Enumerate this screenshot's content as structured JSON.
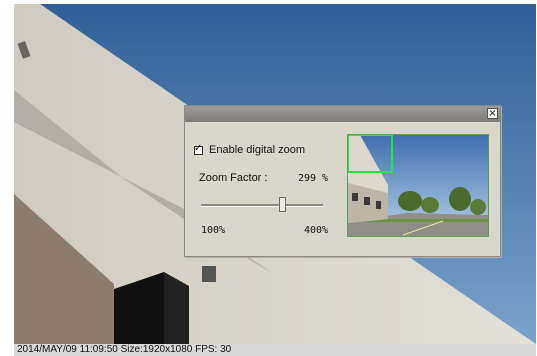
{
  "status_bar": {
    "text": "2014/MAY/09 11:09:50 Size:1920x1080 FPS: 30"
  },
  "zoom_dialog": {
    "close_glyph": "×",
    "enable_label": "Enable digital zoom",
    "enable_checked": true,
    "zoom_factor_label": "Zoom Factor :",
    "zoom_factor_value": "299",
    "zoom_factor_unit": "%",
    "slider": {
      "min_label": "100%",
      "max_label": "400%",
      "min": 100,
      "max": 400,
      "value": 299
    }
  },
  "icons": {
    "close": "close-icon",
    "check": "check-icon"
  },
  "colors": {
    "sky": "#4f7cae",
    "zoom_region": "#25e640",
    "dialog_bg": "#d9d6cc"
  }
}
